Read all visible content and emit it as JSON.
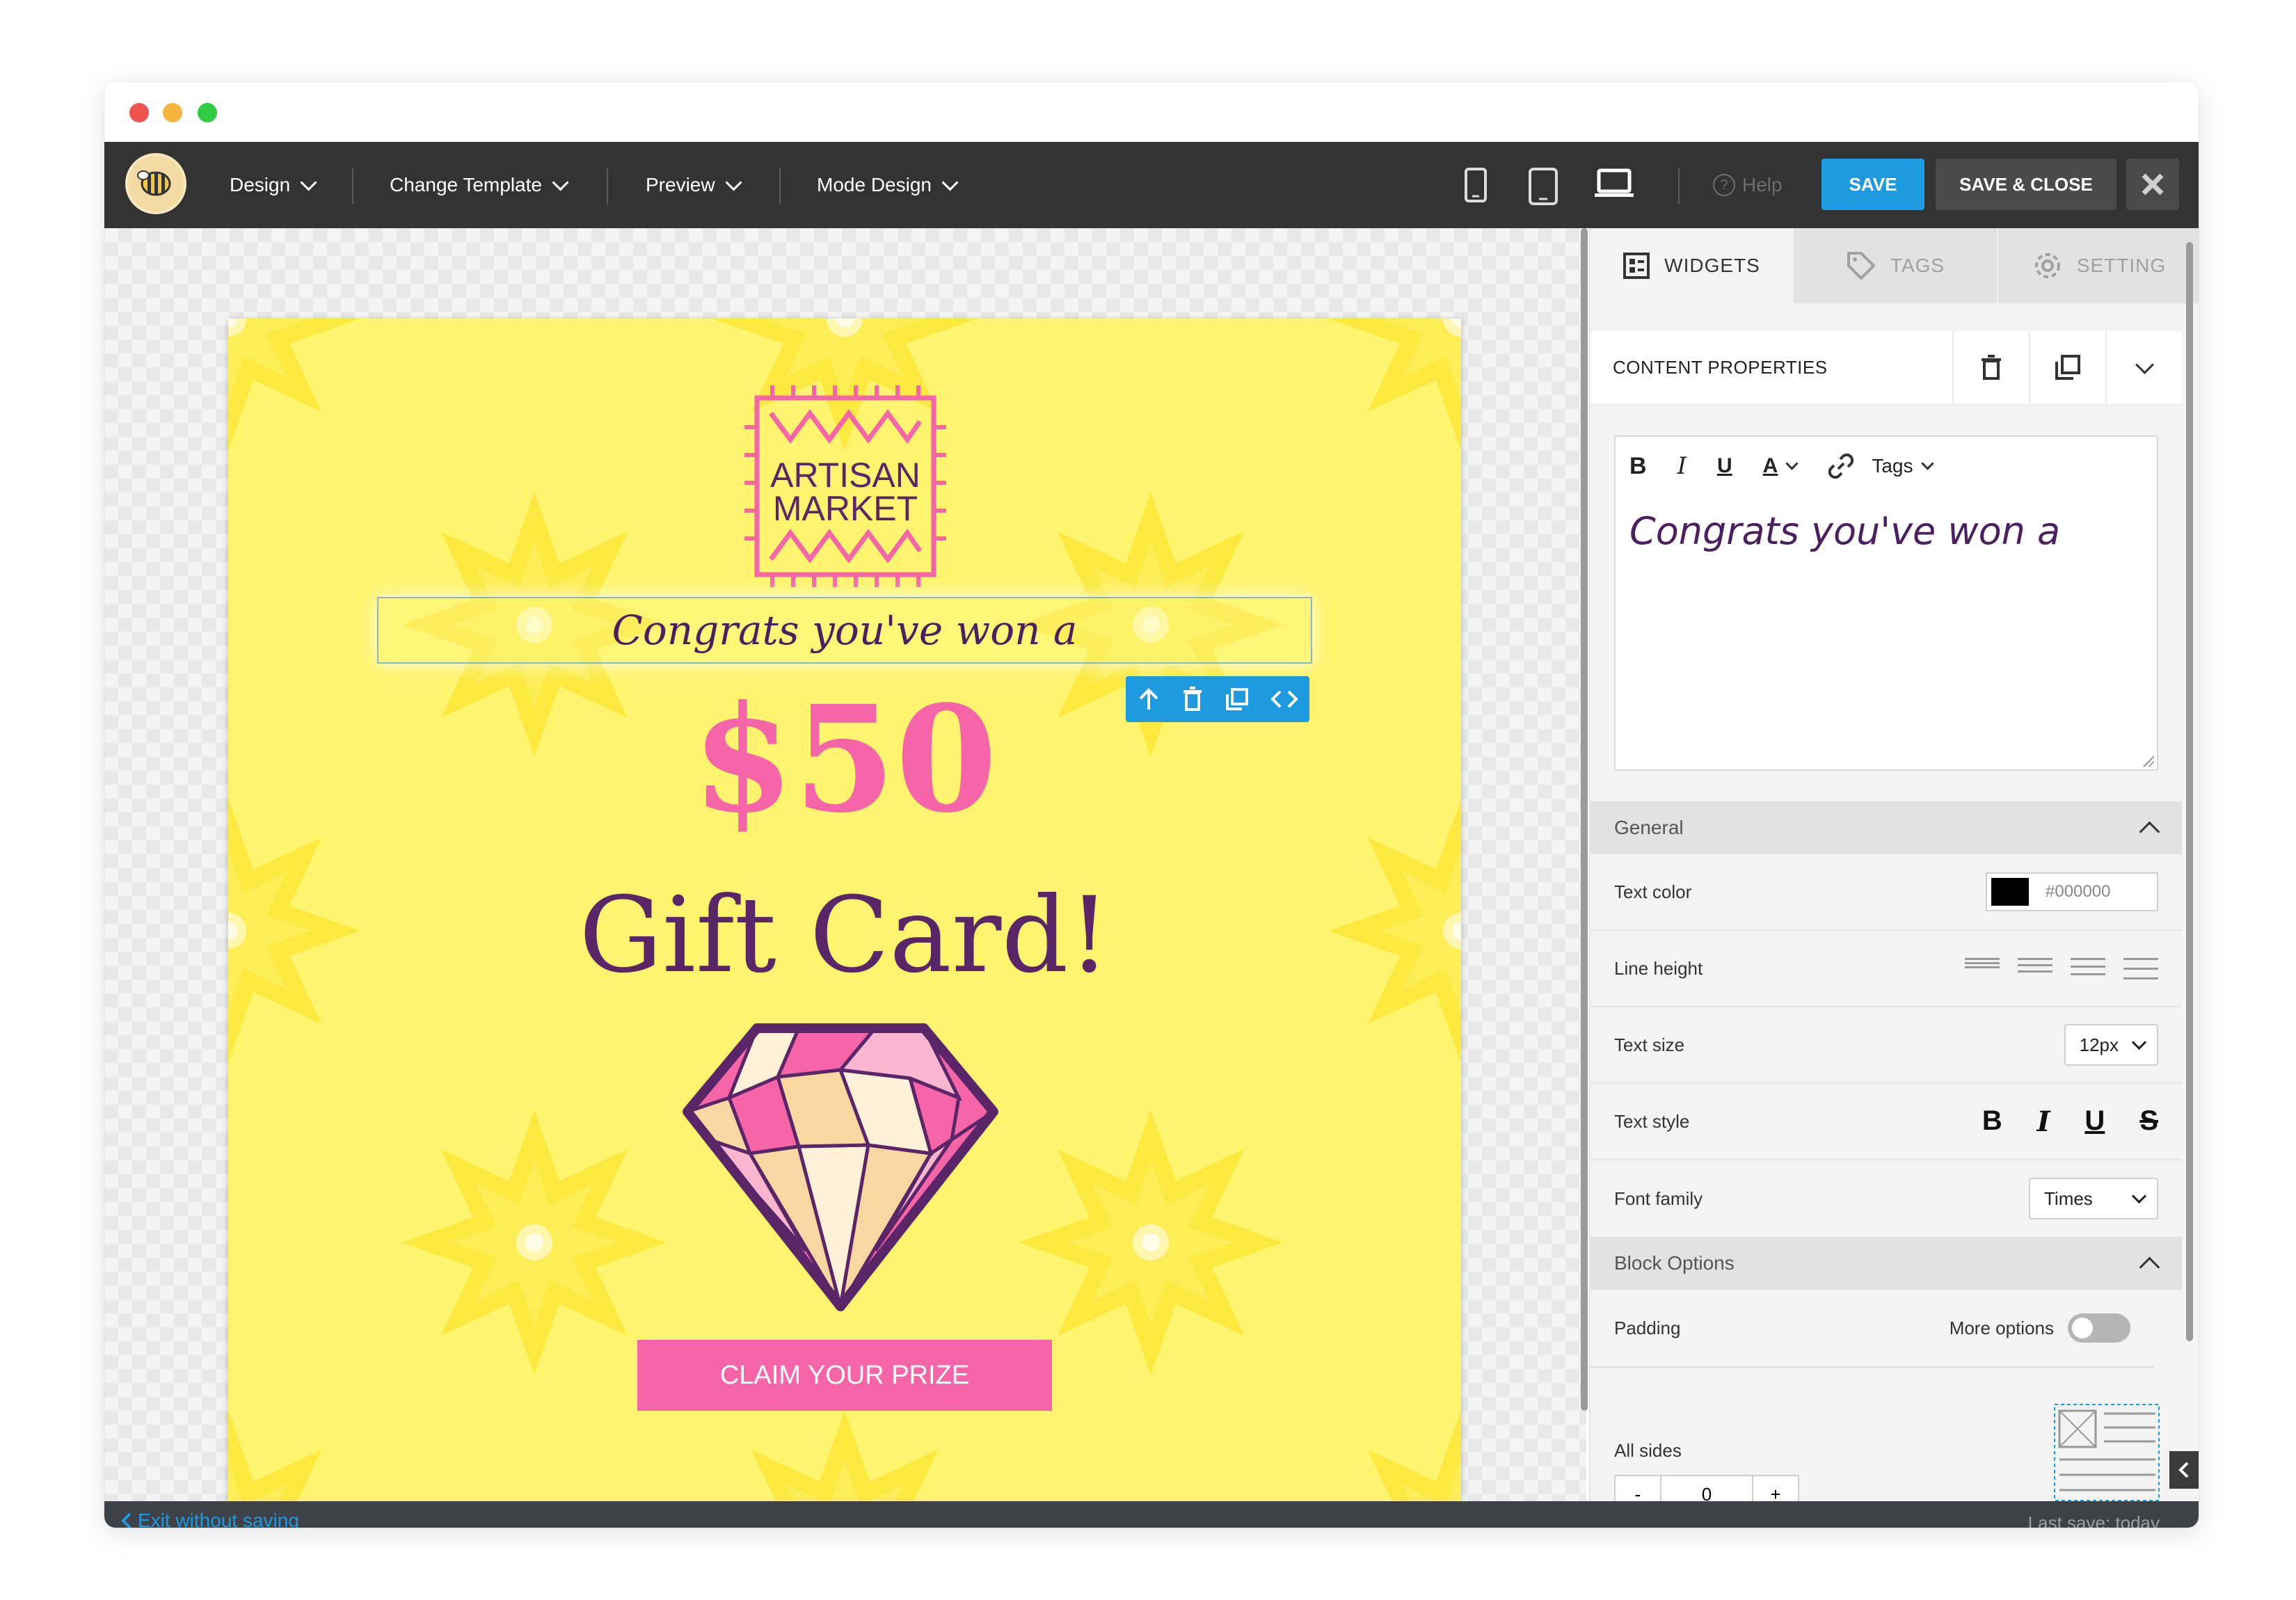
{
  "toolbar": {
    "menus": [
      {
        "label": "Design"
      },
      {
        "label": "Change Template"
      },
      {
        "label": "Preview"
      },
      {
        "label": "Mode Design"
      }
    ],
    "help_label": "Help",
    "save_label": "SAVE",
    "save_close_label": "SAVE & CLOSE"
  },
  "email": {
    "logo_line1": "ARTISAN",
    "logo_line2": "MARKET",
    "headline": "Congrats you've won a",
    "amount": "$50",
    "gift_card": "Gift Card!",
    "cta": "CLAIM YOUR PRIZE"
  },
  "panel": {
    "tabs": [
      {
        "label": "WIDGETS",
        "icon": "widgets-icon"
      },
      {
        "label": "TAGS",
        "icon": "tag-icon"
      },
      {
        "label": "SETTING",
        "icon": "gear-icon"
      }
    ],
    "content_properties": "CONTENT PROPERTIES",
    "editor": {
      "tags_label": "Tags",
      "text": "Congrats you've won a"
    },
    "general_label": "General",
    "text_color_label": "Text color",
    "text_color_value": "#000000",
    "line_height_label": "Line height",
    "text_size_label": "Text size",
    "text_size_value": "12px",
    "text_style_label": "Text style",
    "font_family_label": "Font family",
    "font_family_value": "Times",
    "block_options_label": "Block Options",
    "padding_label": "Padding",
    "more_options_label": "More options",
    "all_sides_label": "All sides",
    "padding_value": "0",
    "minus": "-",
    "plus": "+"
  },
  "status": {
    "exit_label": "Exit without saving",
    "last_save": "Last save: today"
  },
  "colors": {
    "accent": "#1e9ae0",
    "email_bg": "#fff46d",
    "pink": "#f565a8",
    "purple": "#5a2668"
  }
}
